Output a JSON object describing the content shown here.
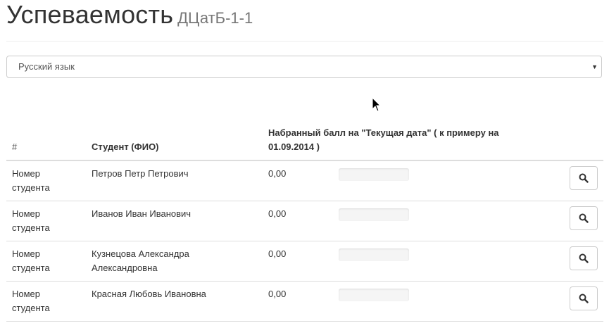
{
  "header": {
    "title": "Успеваемость",
    "subtitle": "ДЦатБ-1-1"
  },
  "subject_select": {
    "selected": "Русский язык"
  },
  "table": {
    "headers": {
      "num": "#",
      "student": "Студент (ФИО)",
      "score": "Набранный балл на \"Текущая дата\" ( к примеру на 01.09.2014 )"
    },
    "rows": [
      {
        "num": "Номер студента",
        "name": "Петров Петр Петрович",
        "score": "0,00",
        "progress": 0
      },
      {
        "num": "Номер студента",
        "name": "Иванов Иван Иванович",
        "score": "0,00",
        "progress": 0
      },
      {
        "num": "Номер студента",
        "name": "Кузнецова Александра Александровна",
        "score": "0,00",
        "progress": 0
      },
      {
        "num": "Номер студента",
        "name": "Красная Любовь Ивановна",
        "score": "0,00",
        "progress": 0
      }
    ]
  },
  "icons": {
    "row_action": "search-icon",
    "select_caret": "caret-down-icon"
  }
}
